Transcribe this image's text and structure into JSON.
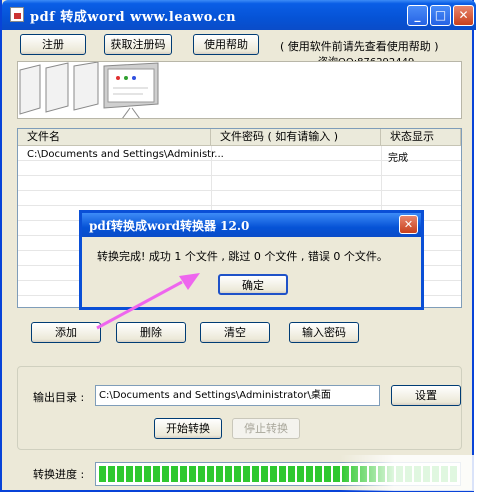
{
  "window": {
    "title": "pdf 转成word www.leawo.cn",
    "controls": {
      "minimize": "_",
      "maximize": "□",
      "close": "✕"
    }
  },
  "toolbar": {
    "register_label": "注册",
    "get_code_label": "获取注册码",
    "help_label": "使用帮助",
    "info_text": "( 使用软件前请先查看使用帮助 )",
    "contact_text": "咨询QQ:876292449"
  },
  "file_table": {
    "columns": [
      "文件名",
      "文件密码 ( 如有请输入 )",
      "状态显示"
    ],
    "rows": [
      {
        "name": "C:\\Documents and Settings\\Administr...",
        "password": "",
        "status": "完成"
      }
    ]
  },
  "dialog": {
    "title": "pdf转换成word转换器 12.0",
    "message": "转换完成! 成功 1 个文件 , 跳过 0 个文件 , 错误 0 个文件。",
    "ok_label": "确定",
    "close": "✕"
  },
  "actions": {
    "add_label": "添加",
    "delete_label": "删除",
    "clear_label": "清空",
    "password_label": "输入密码"
  },
  "output": {
    "dir_label": "输出目录 :",
    "dir_value": "C:\\Documents and Settings\\Administrator\\桌面",
    "set_label": "设置",
    "start_label": "开始转换",
    "stop_label": "停止转换"
  },
  "progress": {
    "label": "转换进度 :",
    "value": 1.0
  },
  "colors": {
    "titlebar": "#0653d6",
    "window_bg": "#ece9d8",
    "progress": "#2ec82e",
    "arrow": "#ee66ee"
  }
}
